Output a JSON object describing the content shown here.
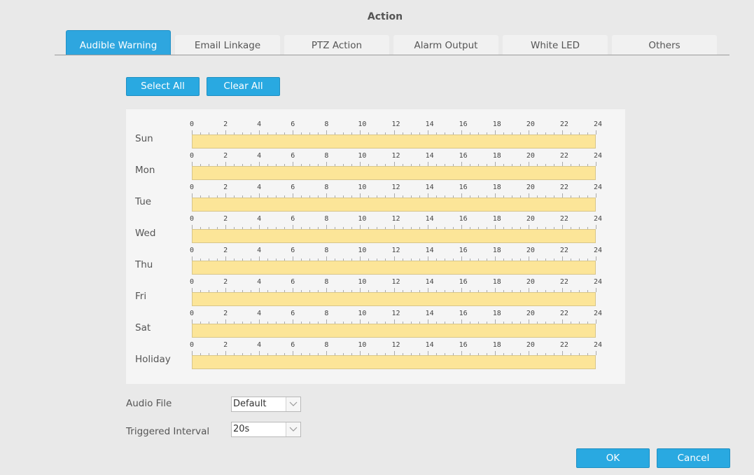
{
  "header": {
    "title": "Action"
  },
  "tabs": [
    {
      "label": "Audible Warning",
      "active": true
    },
    {
      "label": "Email Linkage",
      "active": false
    },
    {
      "label": "PTZ Action",
      "active": false
    },
    {
      "label": "Alarm Output",
      "active": false
    },
    {
      "label": "White LED",
      "active": false
    },
    {
      "label": "Others",
      "active": false
    }
  ],
  "schedule_buttons": {
    "select_all": "Select All",
    "clear_all": "Clear All"
  },
  "schedule": {
    "hour_labels": [
      "0",
      "2",
      "4",
      "6",
      "8",
      "10",
      "12",
      "14",
      "16",
      "18",
      "20",
      "22",
      "24"
    ],
    "days": [
      "Sun",
      "Mon",
      "Tue",
      "Wed",
      "Thu",
      "Fri",
      "Sat",
      "Holiday"
    ],
    "selected_range": [
      0,
      24
    ],
    "bar_color": "#fce598"
  },
  "audio_file": {
    "label": "Audio File",
    "value": "Default"
  },
  "triggered_interval": {
    "label": "Triggered Interval",
    "value": "20s"
  },
  "footer": {
    "ok": "OK",
    "cancel": "Cancel"
  },
  "colors": {
    "accent": "#29a9e1"
  }
}
